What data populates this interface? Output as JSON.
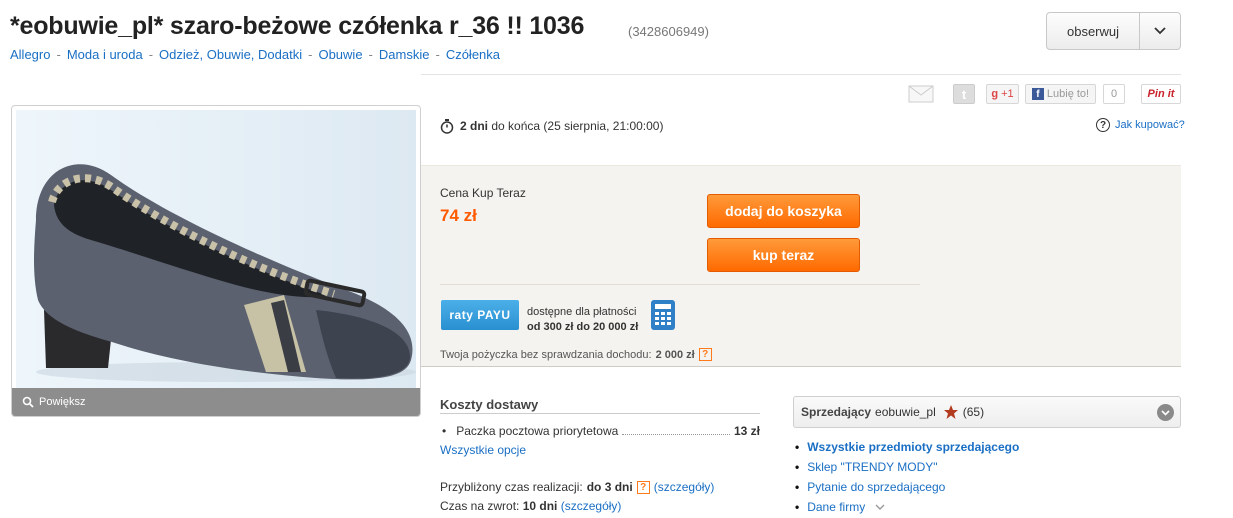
{
  "header": {
    "title": "*eobuwie_pl* szaro-beżowe czółenka r_36 !! 1036",
    "item_id": "(3428606949)"
  },
  "watch": {
    "label": "obserwuj"
  },
  "breadcrumb": [
    "Allegro",
    "Moda i uroda",
    "Odzież, Obuwie, Dodatki",
    "Obuwie",
    "Damskie",
    "Czółenka"
  ],
  "social": {
    "gplus": "+1",
    "like": "Lubię to!",
    "like_count": "0",
    "pinit": "Pin it"
  },
  "image": {
    "zoom_label": "Powiększ"
  },
  "timer": {
    "days": "2 dni",
    "rest": "do końca (25 sierpnia, 21:00:00)"
  },
  "howto": {
    "label": "Jak kupować?"
  },
  "price": {
    "label": "Cena Kup Teraz",
    "value": "74 zł",
    "cart_button": "dodaj do koszyka",
    "buy_button": "kup teraz"
  },
  "payu": {
    "logo": "raty PAYU",
    "line1": "dostępne dla płatności",
    "line2": "od 300 zł do 20 000 zł",
    "loan_prefix": "Twoja pożyczka bez sprawdzania dochodu:",
    "loan_value": "2 000 zł"
  },
  "shipping": {
    "title": "Koszty dostawy",
    "method": "Paczka pocztowa priorytetowa",
    "price": "13 zł",
    "all_options": "Wszystkie opcje",
    "realization_label": "Przybliżony czas realizacji:",
    "realization_value": "do 3 dni",
    "details": "(szczegóły)",
    "return_label": "Czas na zwrot:",
    "return_value": "10 dni",
    "return_details": "(szczegóły)"
  },
  "seller": {
    "label": "Sprzedający",
    "name": "eobuwie_pl",
    "rating": "(65)",
    "links": [
      "Wszystkie przedmioty sprzedającego",
      "Sklep \"TRENDY MODY\"",
      "Pytanie do sprzedającego",
      "Dane firmy"
    ]
  },
  "colors": {
    "accent": "#ff6a00",
    "link": "#1a6fc4",
    "price": "#ff5a00"
  }
}
